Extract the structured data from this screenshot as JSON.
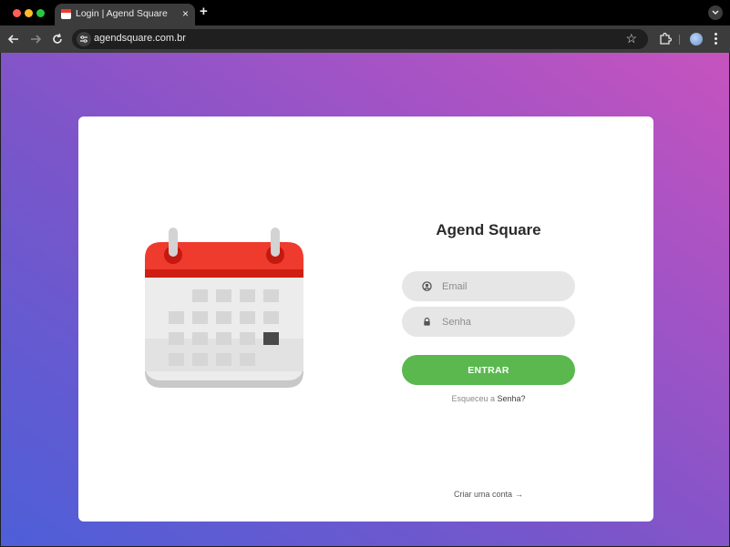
{
  "browser": {
    "tab_title": "Login | Agend Square",
    "tab_close": "×",
    "new_tab": "+",
    "url": "agendsquare.com.br",
    "bookmark_star": "☆"
  },
  "icons": {
    "favicon": "calendar-icon",
    "email": "user-circle-icon",
    "password": "lock-icon",
    "arrow": "arrow-right-icon"
  },
  "login": {
    "title": "Agend Square",
    "email_placeholder": "Email",
    "password_placeholder": "Senha",
    "submit_label": "ENTRAR",
    "forgot_prefix": "Esqueceu a",
    "forgot_link": "Senha?",
    "create_account": "Criar uma conta",
    "create_arrow": "→"
  },
  "colors": {
    "primary_button": "#5ab84f",
    "calendar_red": "#ef3b2d",
    "gradient_start": "#4d5fd8",
    "gradient_end": "#c653be"
  }
}
